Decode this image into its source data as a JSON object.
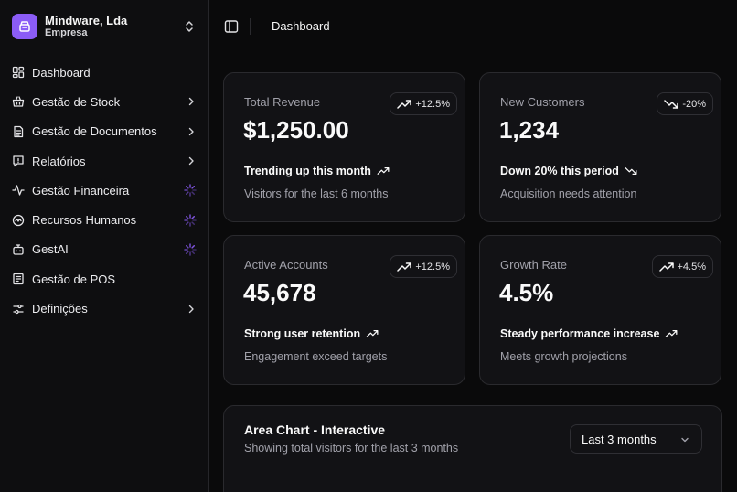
{
  "sidebar": {
    "org": {
      "name": "Mindware, Lda",
      "subtitle": "Empresa"
    },
    "items": [
      {
        "label": "Dashboard",
        "icon": "dashboard-icon",
        "trail": "none"
      },
      {
        "label": "Gestão de Stock",
        "icon": "basket-icon",
        "trail": "chevron"
      },
      {
        "label": "Gestão de Documentos",
        "icon": "document-icon",
        "trail": "chevron"
      },
      {
        "label": "Relatórios",
        "icon": "message-alert-icon",
        "trail": "chevron"
      },
      {
        "label": "Gestão Financeira",
        "icon": "activity-icon",
        "trail": "spinner"
      },
      {
        "label": "Recursos Humanos",
        "icon": "hr-icon",
        "trail": "spinner"
      },
      {
        "label": "GestAI",
        "icon": "bot-icon",
        "trail": "spinner"
      },
      {
        "label": "Gestão de POS",
        "icon": "pos-icon",
        "trail": "none"
      },
      {
        "label": "Definições",
        "icon": "settings-sliders-icon",
        "trail": "chevron"
      }
    ]
  },
  "header": {
    "breadcrumb": "Dashboard"
  },
  "cards": [
    {
      "label": "Total Revenue",
      "value": "$1,250.00",
      "badge": "+12.5%",
      "trend": "up",
      "footer_title": "Trending up this month",
      "footer_sub": "Visitors for the last 6 months"
    },
    {
      "label": "New Customers",
      "value": "1,234",
      "badge": "-20%",
      "trend": "down",
      "footer_title": "Down 20% this period",
      "footer_sub": "Acquisition needs attention"
    },
    {
      "label": "Active Accounts",
      "value": "45,678",
      "badge": "+12.5%",
      "trend": "up",
      "footer_title": "Strong user retention",
      "footer_sub": "Engagement exceed targets"
    },
    {
      "label": "Growth Rate",
      "value": "4.5%",
      "badge": "+4.5%",
      "trend": "up",
      "footer_title": "Steady performance increase",
      "footer_sub": "Meets growth projections"
    }
  ],
  "chart_panel": {
    "title": "Area Chart - Interactive",
    "subtitle": "Showing total visitors for the last 3 months",
    "range_select": "Last 3 months"
  },
  "colors": {
    "accent": "#8b5cf6",
    "background": "#0a0a0b",
    "card": "#121215"
  }
}
